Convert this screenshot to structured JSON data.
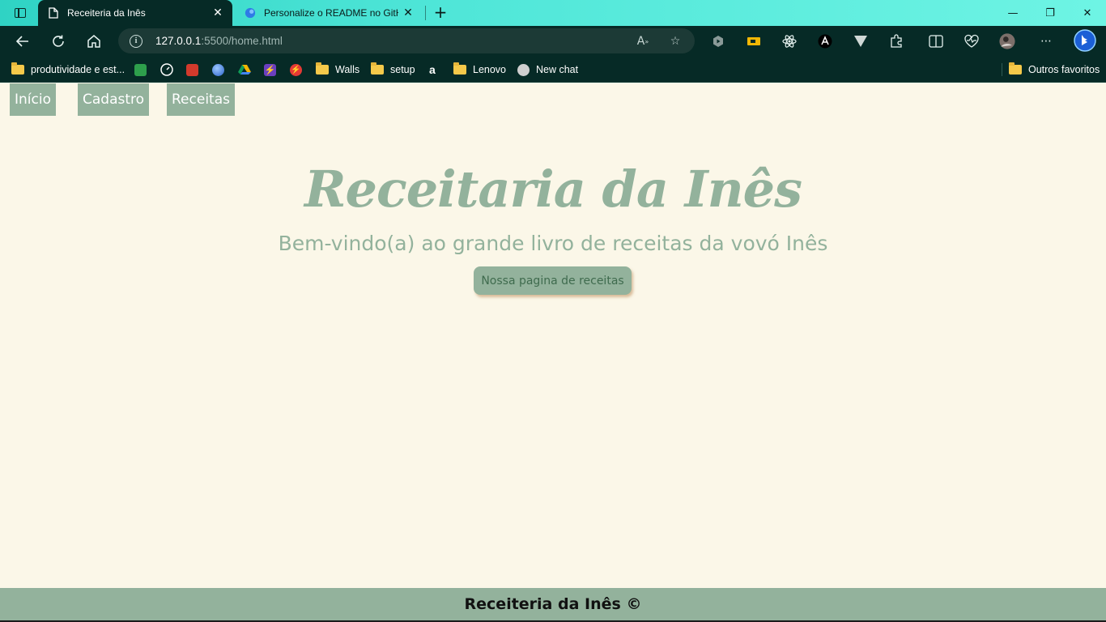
{
  "browser": {
    "tabs": [
      {
        "title": "Receiteria da Inês",
        "active": true
      },
      {
        "title": "Personalize o README no GitHub",
        "active": false
      }
    ],
    "close_glyph": "✕",
    "new_tab_glyph": "+",
    "window_controls": {
      "minimize": "—",
      "restore": "❐",
      "close": "✕"
    },
    "address": {
      "host": "127.0.0.1",
      "path": ":5500/home.html"
    },
    "bookmarks": [
      {
        "label": "produtividade e est...",
        "icon": "folder-icon"
      },
      {
        "label": "",
        "icon": "meet-icon",
        "color": "#2e9f4c"
      },
      {
        "label": "",
        "icon": "speed-icon",
        "color": "#1a1a1a"
      },
      {
        "label": "",
        "icon": "red-app-icon",
        "color": "#d33a2c"
      },
      {
        "label": "",
        "icon": "globe-icon",
        "color": "#3a7be0"
      },
      {
        "label": "",
        "icon": "drive-icon",
        "color": "#f4b400"
      },
      {
        "label": "",
        "icon": "bolt-icon",
        "color": "#6b3fbf"
      },
      {
        "label": "",
        "icon": "red-bolt-icon",
        "color": "#e53935"
      },
      {
        "label": "Walls",
        "icon": "folder-icon"
      },
      {
        "label": "setup",
        "icon": "folder-icon"
      },
      {
        "label": "",
        "icon": "a-logo-icon",
        "color": "#ffffff"
      },
      {
        "label": "Lenovo",
        "icon": "folder-icon"
      },
      {
        "label": "New chat",
        "icon": "chatgpt-icon",
        "color": "#cfcfcf"
      }
    ],
    "other_favorites": "Outros favoritos"
  },
  "nav": {
    "items": [
      "Início",
      "Cadastro",
      "Receitas"
    ]
  },
  "hero": {
    "title": "Receitaria da Inês",
    "subtitle": "Bem-vindo(a) ao grande livro de receitas da vovó Inês",
    "cta": "Nossa pagina de receitas"
  },
  "footer": {
    "text": "Receiteria da Inês ©"
  },
  "colors": {
    "accent": "#93b29c",
    "background": "#fbf7e8",
    "chrome": "#062a26"
  }
}
